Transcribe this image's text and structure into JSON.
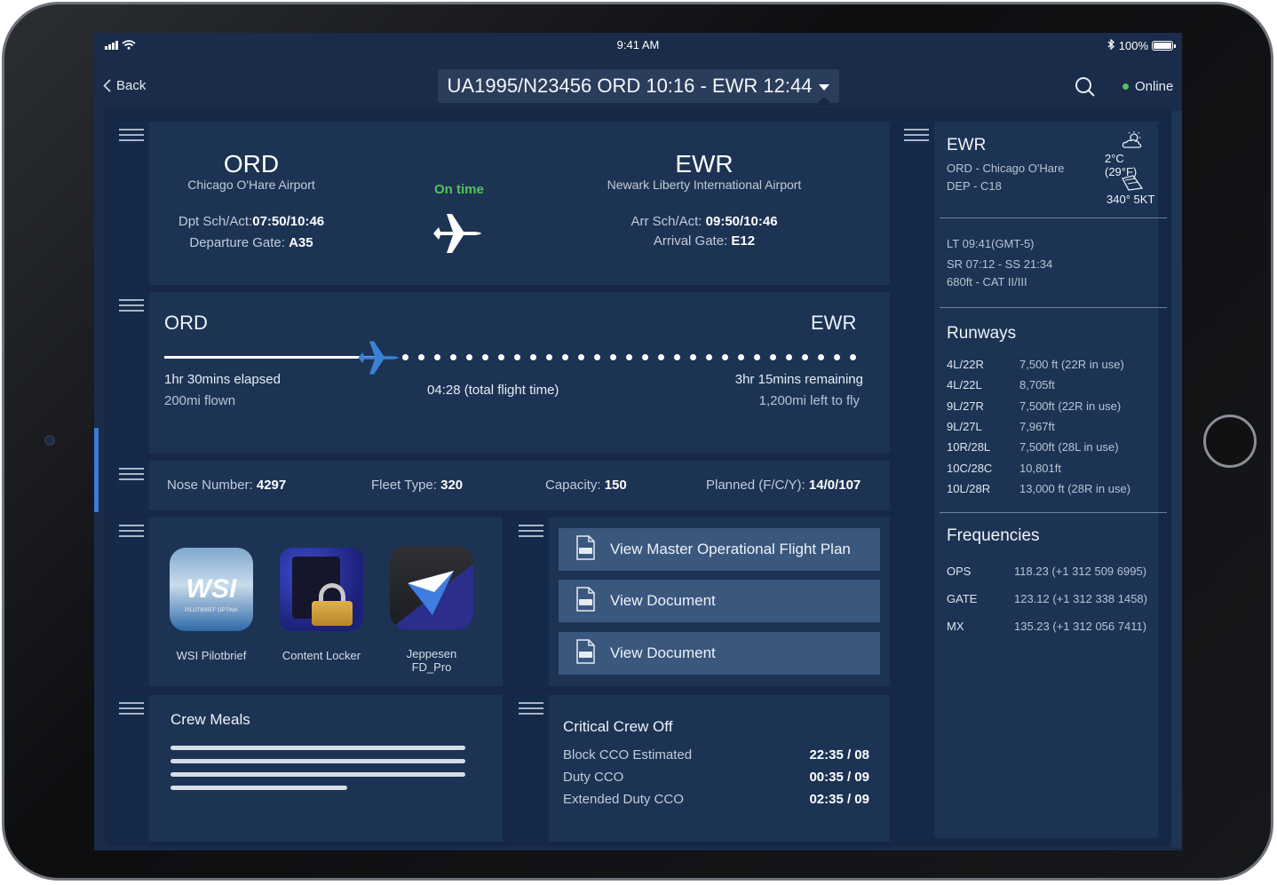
{
  "status": {
    "time": "9:41 AM",
    "battery": "100%"
  },
  "nav": {
    "back": "Back",
    "flight": "UA1995/N23456 ORD 10:16 - EWR 12:44",
    "online": "Online"
  },
  "route": {
    "origin_code": "ORD",
    "origin_name": "Chicago O'Hare Airport",
    "dep_label": "Dpt Sch/Act:",
    "dep_value": "07:50/10:46",
    "dgate_label": "Departure Gate:",
    "dgate_value": "A35",
    "status": "On time",
    "dest_code": "EWR",
    "dest_name": "Newark Liberty International Airport",
    "arr_label": "Arr Sch/Act:",
    "arr_value": "09:50/10:46",
    "agate_label": "Arrival Gate:",
    "agate_value": "E12"
  },
  "progress": {
    "from": "ORD",
    "to": "EWR",
    "fraction": 0.31,
    "elapsed": "1hr  30mins elapsed",
    "flown": "200mi flown",
    "total": "04:28 (total flight time)",
    "remaining": "3hr  15mins remaining",
    "left": "1,200mi left to fly"
  },
  "fleet": {
    "nose_label": "Nose Number:",
    "nose_value": "4297",
    "type_label": "Fleet Type:",
    "type_value": "320",
    "cap_label": "Capacity:",
    "cap_value": "150",
    "plan_label": "Planned (F/C/Y):",
    "plan_value": "14/0/107"
  },
  "apps": [
    {
      "label": "WSI Pilotbrief",
      "icon": "wsi-icon",
      "logo": "WSI",
      "logo_sub": "PILOTBRIEF OPTIMA"
    },
    {
      "label": "Content Locker",
      "icon": "lock-icon"
    },
    {
      "label": "Jeppesen FD_Pro",
      "icon": "jeppesen-icon"
    }
  ],
  "documents": [
    "View Master Operational Flight Plan",
    "View Document",
    "View Document"
  ],
  "meals": {
    "title": "Crew Meals",
    "line_lengths": [
      1.0,
      1.0,
      1.0,
      0.6
    ]
  },
  "crew": {
    "title": "Critical Crew Off",
    "rows": [
      {
        "label": "Block CCO Estimated",
        "value": "22:35 / 08"
      },
      {
        "label": "Duty CCO",
        "value": "00:35 / 09"
      },
      {
        "label": "Extended Duty CCO",
        "value": "02:35 / 09"
      }
    ]
  },
  "weather": {
    "code": "EWR",
    "line1": "ORD - Chicago  O'Hare",
    "line2": "DEP - C18",
    "temp": "2°C (29°F)",
    "wind": "340° 5KT",
    "lt": "LT 09:41(GMT-5)",
    "sun": "SR 07:12 - SS 21:34",
    "cat": "680ft - CAT II/III"
  },
  "runways": {
    "title": "Runways",
    "rows": [
      {
        "name": "4L/22R",
        "info": "7,500 ft (22R in use)"
      },
      {
        "name": "4L/22L",
        "info": "8,705ft"
      },
      {
        "name": "9L/27R",
        "info": "7,500ft (22R in use)"
      },
      {
        "name": "9L/27L",
        "info": "7,967ft"
      },
      {
        "name": "10R/28L",
        "info": "7,500ft (28L in use)"
      },
      {
        "name": "10C/28C",
        "info": "10,801ft"
      },
      {
        "name": "10L/28R",
        "info": "13,000 ft (28R in use)"
      }
    ]
  },
  "frequencies": {
    "title": "Frequencies",
    "rows": [
      {
        "name": "OPS",
        "info": "118.23 (+1 312 509 6995)"
      },
      {
        "name": "GATE",
        "info": "123.12 (+1 312 338 1458)"
      },
      {
        "name": "MX",
        "info": "135.23 (+1 312 056 7411)"
      }
    ]
  }
}
